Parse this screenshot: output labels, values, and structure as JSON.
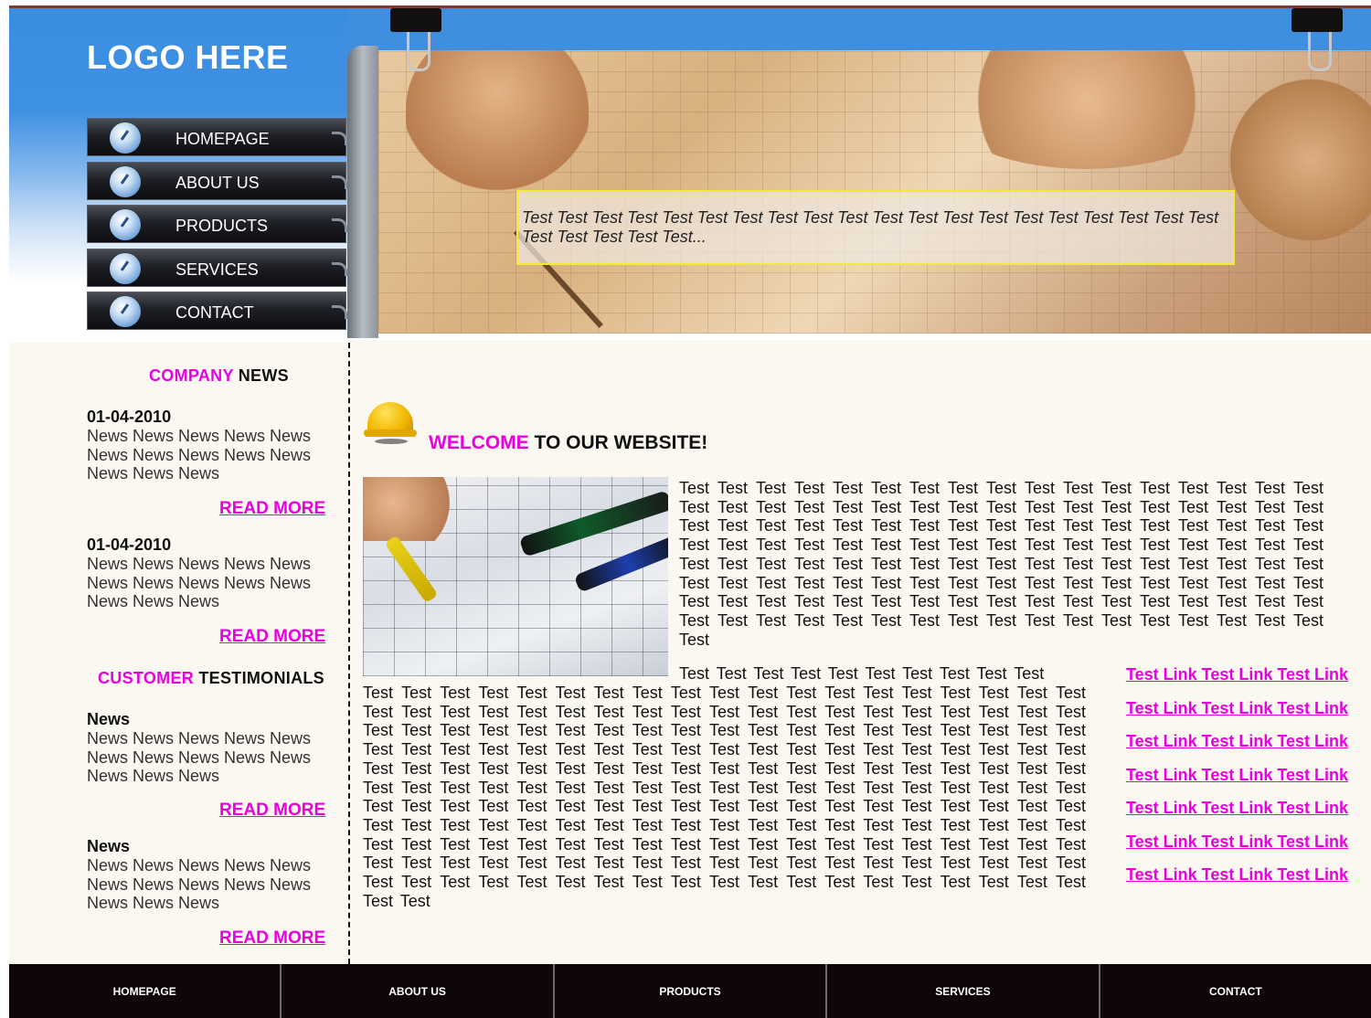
{
  "header": {
    "logo": "LOGO HERE",
    "banner_text": "Test Test Test Test Test Test Test Test Test Test Test Test Test Test Test Test Test Test Test Test Test Test Test Test Test..."
  },
  "nav": {
    "items": [
      {
        "label": "HOMEPAGE"
      },
      {
        "label": "ABOUT US"
      },
      {
        "label": "PRODUCTS"
      },
      {
        "label": "SERVICES"
      },
      {
        "label": "CONTACT"
      }
    ]
  },
  "company_news": {
    "heading_highlight": "COMPANY",
    "heading_rest": " NEWS",
    "items": [
      {
        "date": "01-04-2010",
        "body": "News News News News News News News News News News News News News",
        "read_more": "READ MORE"
      },
      {
        "date": "01-04-2010",
        "body": "News News News News News News News News News News News News News",
        "read_more": "READ MORE"
      }
    ]
  },
  "testimonials": {
    "heading_highlight": "CUSTOMER",
    "heading_rest": " TESTIMONIALS",
    "items": [
      {
        "title": "News",
        "body": "News News News News News News News News News News News News News",
        "read_more": "READ MORE"
      },
      {
        "title": "News",
        "body": "News News News News News News News News News News News News News",
        "read_more": "READ MORE"
      }
    ]
  },
  "welcome": {
    "heading_highlight": "WELCOME",
    "heading_rest": " TO OUR WEBSITE!",
    "intro": "Test Test Test Test Test Test Test Test Test Test Test Test Test Test Test Test Test Test Test Test Test Test Test Test Test Test Test Test Test Test Test Test Test Test Test Test Test Test Test Test Test Test Test Test Test Test Test Test Test Test Test Test Test Test Test Test Test Test Test Test Test Test Test Test Test Test Test Test Test Test Test Test Test Test Test Test Test Test Test Test Test Test Test Test Test Test Test Test Test Test Test Test Test Test Test Test Test Test Test Test Test Test Test Test Test Test Test Test Test Test Test Test Test Test Test Test Test Test Test Test Test Test Test Test Test Test Test Test Test Test Test Test Test Test Test Test Test",
    "para_first_line": "Test Test Test Test Test Test Test Test Test Test",
    "para": "Test Test Test Test Test Test Test Test Test Test Test Test Test Test Test Test Test Test Test Test Test Test Test Test Test Test Test Test Test Test Test Test Test Test Test Test Test Test Test Test Test Test Test Test Test Test Test Test Test Test Test Test Test Test Test Test Test Test Test Test Test Test Test Test Test Test Test Test Test Test Test Test Test Test Test Test Test Test Test Test Test Test Test Test Test Test Test Test Test Test Test Test Test Test Test Test Test Test Test Test Test Test Test Test Test Test Test Test Test Test Test Test Test Test Test Test Test Test Test Test Test Test Test Test Test Test Test Test Test Test Test Test Test Test Test Test Test Test Test Test Test Test Test Test Test Test Test Test Test Test Test Test Test Test Test Test Test Test Test Test Test Test Test Test Test Test Test Test Test Test Test Test Test Test Test Test Test Test Test Test Test Test Test Test Test Test Test Test Test Test Test Test Test Test Test Test Test Test Test Test Test Test Test Test Test Test Test Test Test Test Test"
  },
  "links": [
    "Test Link Test Link Test Link",
    "Test Link Test Link Test Link",
    "Test Link Test Link Test Link",
    "Test Link Test Link Test Link",
    "Test Link Test Link Test Link",
    "Test Link Test Link Test Link",
    "Test Link Test Link Test Link"
  ],
  "footer": {
    "items": [
      "HOMEPAGE",
      "ABOUT US",
      "PRODUCTS",
      "SERVICES",
      "CONTACT"
    ]
  },
  "colors": {
    "accent": "#e800e0",
    "header_blue": "#3a8ee2",
    "footer_bg": "#0f0607",
    "content_bg": "#faf8f0"
  }
}
